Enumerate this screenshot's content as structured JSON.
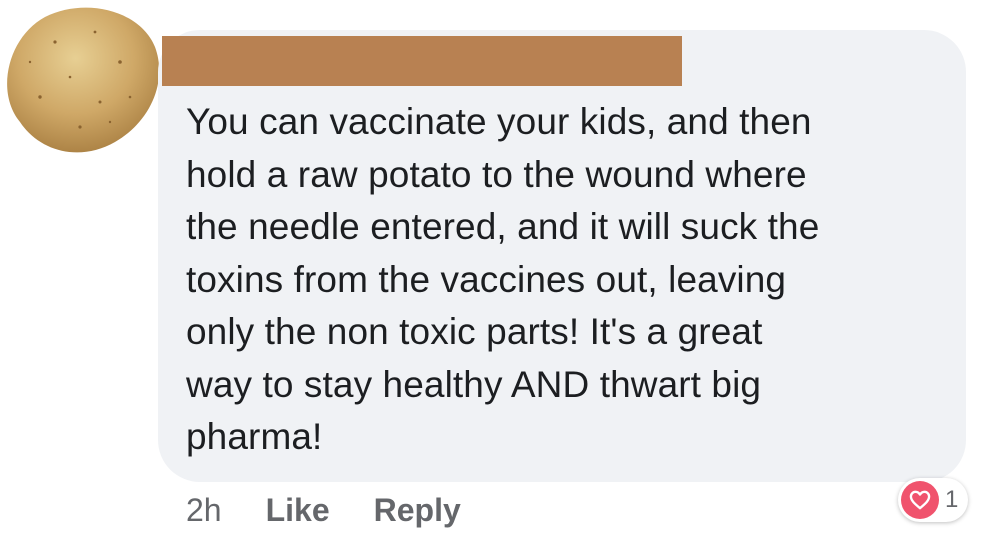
{
  "comment": {
    "avatar_icon": "potato-avatar-icon",
    "author_redacted_color": "#b88152",
    "text": "You can vaccinate your kids, and then\nhold a raw potato to the wound where\nthe needle entered, and it will suck the\ntoxins from the vaccines out, leaving\nonly the non toxic parts! It's a great\nway to stay healthy AND thwart big\npharma!",
    "bubble_color": "#f0f2f5"
  },
  "actions": {
    "time": "2h",
    "like_label": "Like",
    "reply_label": "Reply"
  },
  "reactions": {
    "icon": "heart-icon",
    "color": "#f0536d",
    "count": "1"
  }
}
